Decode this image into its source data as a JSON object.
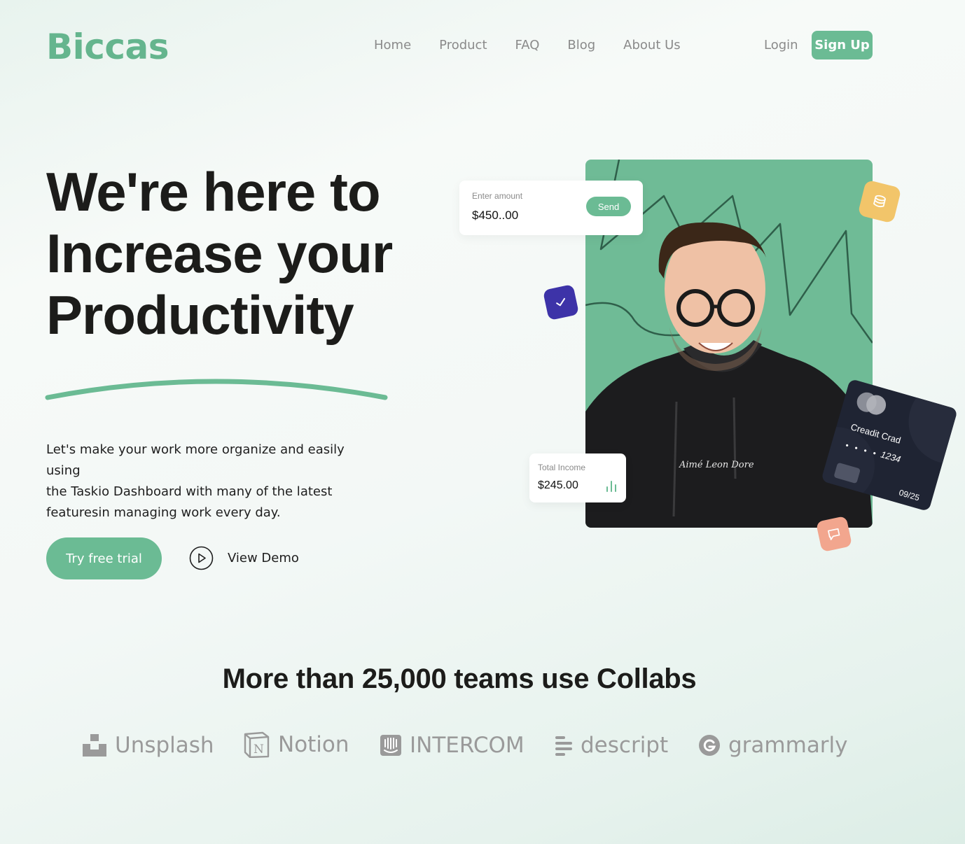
{
  "header": {
    "logo": "Biccas",
    "nav": [
      "Home",
      "Product",
      "FAQ",
      "Blog",
      "About Us"
    ],
    "login": "Login",
    "signup": "Sign Up"
  },
  "hero": {
    "title_lines": [
      "We're here to",
      "Increase your",
      "Productivity"
    ],
    "description_lines": [
      "Let's make your work more organize and easily using",
      "the Taskio Dashboard with many of the latest",
      "featuresin managing work every day."
    ],
    "trial_button": "Try free trial",
    "demo_button": "View Demo"
  },
  "widgets": {
    "amount_card": {
      "caption": "Enter amount",
      "value": "$450..00",
      "send": "Send"
    },
    "income_card": {
      "caption": "Total Income",
      "value": "$245.00"
    },
    "credit_card": {
      "title": "Creadit Crad",
      "masked": "• • • •",
      "number": "1234",
      "expiry": "09/25"
    }
  },
  "social_proof": {
    "headline": "More than 25,000 teams use Collabs",
    "brands": [
      "Unsplash",
      "Notion",
      "INTERCOM",
      "descript",
      "grammarly"
    ]
  },
  "colors": {
    "accent": "#6bbb94",
    "logo": "#65b58e",
    "purple_badge": "#3d33a8",
    "yellow_badge": "#f2c56a",
    "salmon_badge": "#f2a68e",
    "card_dark": "#1f2433"
  }
}
